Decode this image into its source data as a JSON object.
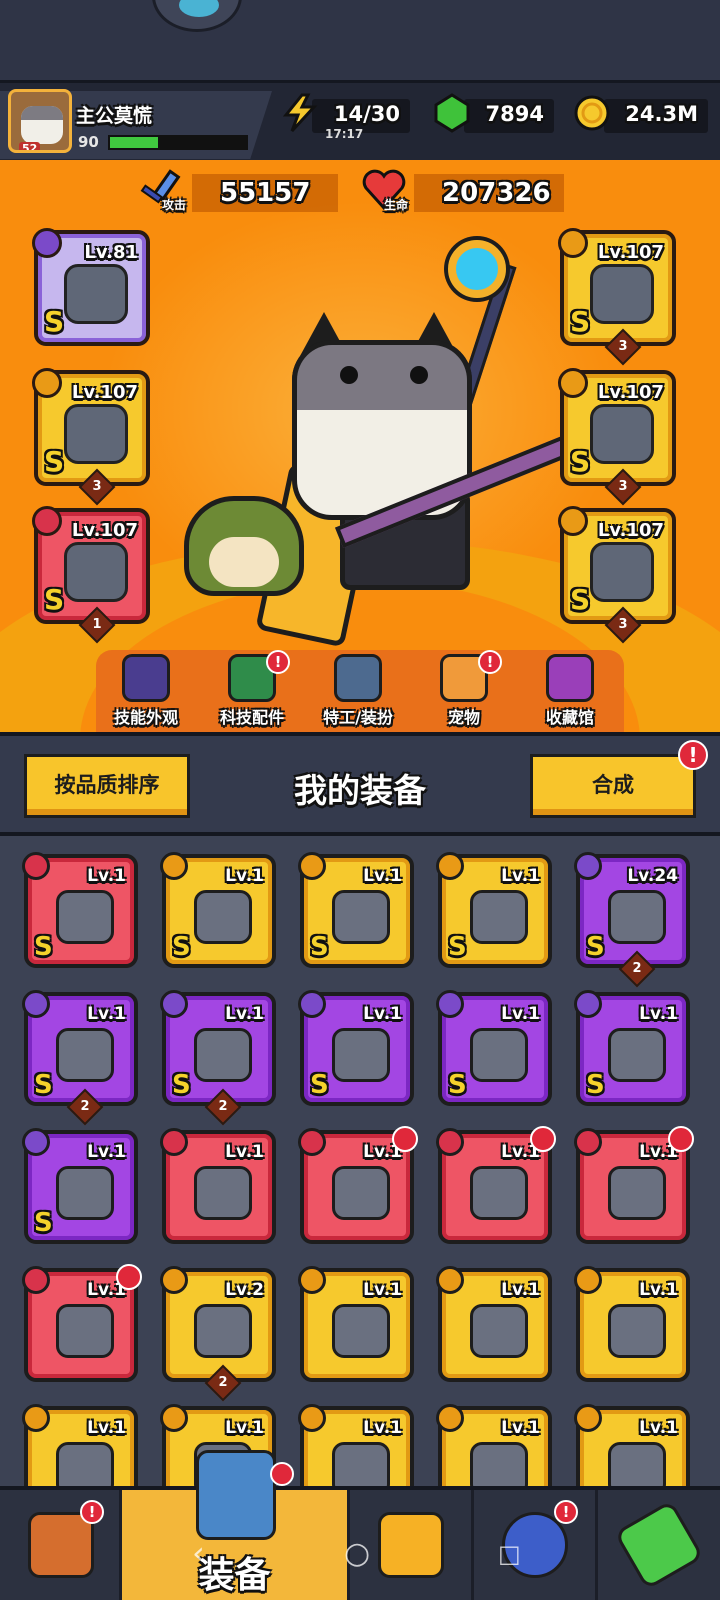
{
  "player": {
    "name": "主公莫慌",
    "level": "52",
    "power": "90",
    "xp_fraction": 0.35
  },
  "resources": {
    "energy": {
      "value": "14/30",
      "timer": "17:17",
      "icon": "lightning-icon"
    },
    "gems": {
      "value": "7894",
      "icon": "green-gem-icon"
    },
    "coins": {
      "value": "24.3M",
      "icon": "gold-coin-icon"
    }
  },
  "stats": {
    "attack": {
      "label": "攻击",
      "value": "55157",
      "icon": "sword-icon"
    },
    "hp": {
      "label": "生命",
      "value": "207326",
      "icon": "heart-icon"
    }
  },
  "equipped": {
    "left": [
      {
        "level": "Lv.81",
        "grade": "S",
        "rarity": "purple",
        "stars": ""
      },
      {
        "level": "Lv.107",
        "grade": "S",
        "rarity": "gold",
        "stars": "3"
      },
      {
        "level": "Lv.107",
        "grade": "S",
        "rarity": "red",
        "stars": "1"
      }
    ],
    "right": [
      {
        "level": "Lv.107",
        "grade": "S",
        "rarity": "gold",
        "stars": "3"
      },
      {
        "level": "Lv.107",
        "grade": "S",
        "rarity": "gold",
        "stars": "3"
      },
      {
        "level": "Lv.107",
        "grade": "S",
        "rarity": "gold",
        "stars": "3"
      }
    ]
  },
  "quick_menu": [
    {
      "label": "技能外观",
      "badge": false
    },
    {
      "label": "科技配件",
      "badge": true
    },
    {
      "label": "特工/装扮",
      "badge": false
    },
    {
      "label": "宠物",
      "badge": true
    },
    {
      "label": "收藏馆",
      "badge": false
    }
  ],
  "section": {
    "title": "我的装备",
    "sort_button": "按品质排序",
    "merge_button": "合成",
    "alert": "!"
  },
  "inventory": [
    {
      "level": "Lv.1",
      "grade": "S",
      "rarity": "red",
      "stars": "",
      "badge": false
    },
    {
      "level": "Lv.1",
      "grade": "S",
      "rarity": "gold",
      "stars": "",
      "badge": false
    },
    {
      "level": "Lv.1",
      "grade": "S",
      "rarity": "gold",
      "stars": "",
      "badge": false
    },
    {
      "level": "Lv.1",
      "grade": "S",
      "rarity": "gold",
      "stars": "",
      "badge": false
    },
    {
      "level": "Lv.24",
      "grade": "S",
      "rarity": "purple",
      "stars": "2",
      "badge": false
    },
    {
      "level": "Lv.1",
      "grade": "S",
      "rarity": "purple",
      "stars": "2",
      "badge": false
    },
    {
      "level": "Lv.1",
      "grade": "S",
      "rarity": "purple",
      "stars": "2",
      "badge": false
    },
    {
      "level": "Lv.1",
      "grade": "S",
      "rarity": "purple",
      "stars": "",
      "badge": false
    },
    {
      "level": "Lv.1",
      "grade": "S",
      "rarity": "purple",
      "stars": "",
      "badge": false
    },
    {
      "level": "Lv.1",
      "grade": "S",
      "rarity": "purple",
      "stars": "",
      "badge": false
    },
    {
      "level": "Lv.1",
      "grade": "S",
      "rarity": "purple",
      "stars": "",
      "badge": false
    },
    {
      "level": "Lv.1",
      "grade": "",
      "rarity": "red",
      "stars": "",
      "badge": false
    },
    {
      "level": "Lv.1",
      "grade": "",
      "rarity": "red",
      "stars": "",
      "badge": true
    },
    {
      "level": "Lv.1",
      "grade": "",
      "rarity": "red",
      "stars": "",
      "badge": true
    },
    {
      "level": "Lv.1",
      "grade": "",
      "rarity": "red",
      "stars": "",
      "badge": true
    },
    {
      "level": "Lv.1",
      "grade": "",
      "rarity": "red",
      "stars": "",
      "badge": true
    },
    {
      "level": "Lv.2",
      "grade": "",
      "rarity": "gold",
      "stars": "2",
      "badge": false
    },
    {
      "level": "Lv.1",
      "grade": "",
      "rarity": "gold",
      "stars": "",
      "badge": false
    },
    {
      "level": "Lv.1",
      "grade": "",
      "rarity": "gold",
      "stars": "",
      "badge": false
    },
    {
      "level": "Lv.1",
      "grade": "",
      "rarity": "gold",
      "stars": "",
      "badge": false
    },
    {
      "level": "Lv.1",
      "grade": "",
      "rarity": "gold",
      "stars": "",
      "badge": false
    },
    {
      "level": "Lv.1",
      "grade": "",
      "rarity": "gold",
      "stars": "",
      "badge": false
    },
    {
      "level": "Lv.1",
      "grade": "",
      "rarity": "gold",
      "stars": "",
      "badge": false
    },
    {
      "level": "Lv.1",
      "grade": "",
      "rarity": "gold",
      "stars": "",
      "badge": false
    },
    {
      "level": "Lv.1",
      "grade": "",
      "rarity": "gold",
      "stars": "",
      "badge": false
    }
  ],
  "bottom_nav": {
    "shop": {
      "icon": "shop-icon",
      "badge": "!"
    },
    "equip": {
      "label": "装备",
      "icon": "equipment-icon"
    },
    "battle": {
      "icon": "crossed-swords-star-icon"
    },
    "egg": {
      "icon": "egg-icon",
      "badge": "!"
    },
    "lab": {
      "icon": "dna-capsule-icon"
    }
  }
}
